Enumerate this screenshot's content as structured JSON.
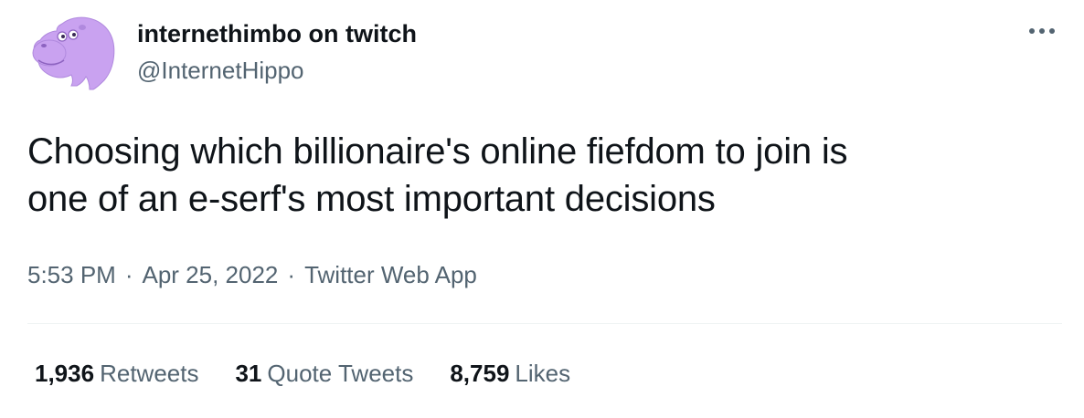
{
  "author": {
    "display_name": "internethimbo on twitch",
    "handle": "@InternetHippo",
    "avatar_icon": "purple-hippo-avatar",
    "avatar_color": "#c9a2f0"
  },
  "tweet": {
    "text_line1": "Choosing which billionaire's online fiefdom to join is",
    "text_line2": "one of an e-serf's most important decisions"
  },
  "meta": {
    "time": "5:53 PM",
    "date": "Apr 25, 2022",
    "source": "Twitter Web App",
    "separator": "·"
  },
  "stats": {
    "retweets_count": "1,936",
    "retweets_label": "Retweets",
    "quotes_count": "31",
    "quotes_label": "Quote Tweets",
    "likes_count": "8,759",
    "likes_label": "Likes"
  },
  "menu": {
    "more_icon": "more-horizontal-icon"
  }
}
